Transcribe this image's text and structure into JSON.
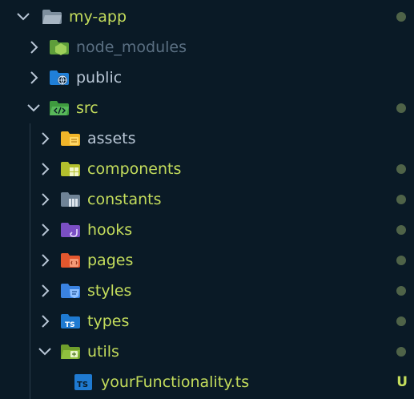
{
  "explorer": {
    "root": {
      "label": "my-app",
      "expanded": true,
      "modified": true
    },
    "items": [
      {
        "label": "node_modules",
        "expanded": false,
        "icon": "node-folder-icon"
      },
      {
        "label": "public",
        "expanded": false,
        "icon": "globe-folder-icon"
      },
      {
        "label": "src",
        "expanded": true,
        "icon": "code-folder-icon",
        "modified": true
      }
    ],
    "src_children": [
      {
        "label": "assets",
        "expanded": false,
        "icon": "assets-folder-icon"
      },
      {
        "label": "components",
        "expanded": false,
        "icon": "components-folder-icon",
        "modified": true
      },
      {
        "label": "constants",
        "expanded": false,
        "icon": "constants-folder-icon",
        "modified": true
      },
      {
        "label": "hooks",
        "expanded": false,
        "icon": "hooks-folder-icon",
        "modified": true
      },
      {
        "label": "pages",
        "expanded": false,
        "icon": "pages-folder-icon",
        "modified": true
      },
      {
        "label": "styles",
        "expanded": false,
        "icon": "styles-folder-icon",
        "modified": true
      },
      {
        "label": "types",
        "expanded": false,
        "icon": "types-folder-icon",
        "modified": true
      },
      {
        "label": "utils",
        "expanded": true,
        "icon": "utils-folder-icon",
        "modified": true
      }
    ],
    "utils_children": [
      {
        "label": "yourFunctionality.ts",
        "icon": "typescript-file-icon",
        "badge": "U"
      }
    ]
  },
  "colors": {
    "background": "#0a1a26",
    "label_modified": "#c4dd5c",
    "label_dim": "#5a6f82",
    "label_plain": "#b9c7d6",
    "dot": "#4f6348"
  }
}
